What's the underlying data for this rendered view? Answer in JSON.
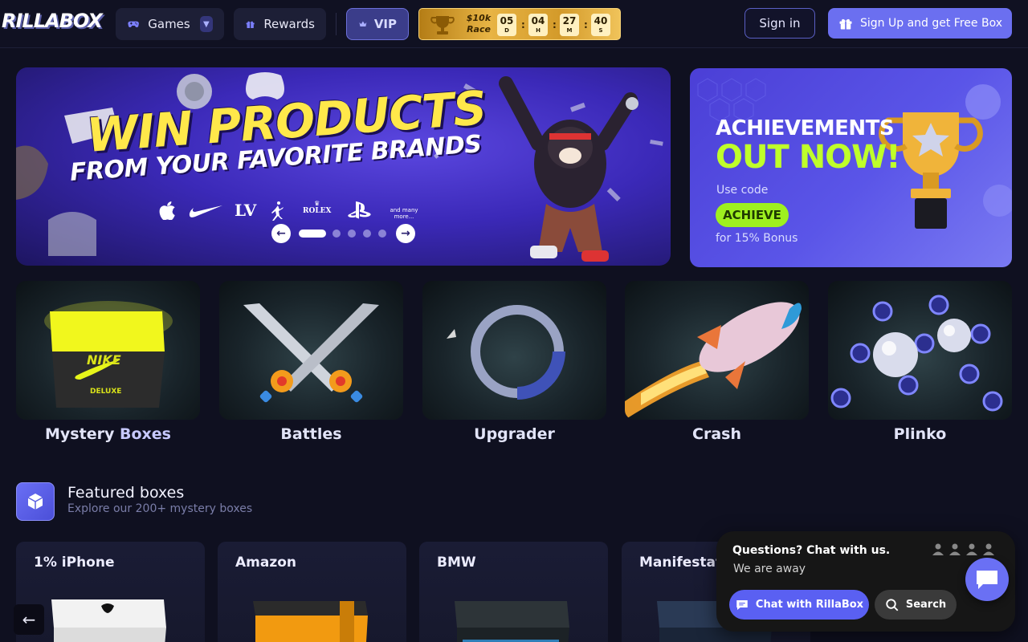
{
  "logo": "RILLABOX",
  "nav": {
    "games_label": "Games",
    "rewards_label": "Rewards",
    "vip_label": "VIP",
    "signin_label": "Sign in",
    "signup_label": "Sign Up and get Free Box"
  },
  "race": {
    "label_line1": "$10k",
    "label_line2": "Race",
    "timer": [
      {
        "value": "05",
        "unit": "D"
      },
      {
        "value": "04",
        "unit": "H"
      },
      {
        "value": "27",
        "unit": "M"
      },
      {
        "value": "40",
        "unit": "S"
      }
    ]
  },
  "hero": {
    "title_line1": "WIN PRODUCTS",
    "title_line2": "FROM YOUR FAVORITE BRANDS",
    "brands": [
      "",
      "NIKE",
      "LV",
      "JORDAN",
      "ROLEX",
      "PS",
      "and many more..."
    ],
    "brand_rolex_text": "ROLEX",
    "brand_more_text": "and many more...",
    "slides_total": 5,
    "active_slide": 1
  },
  "achievements": {
    "line1": "ACHIEVEMENTS",
    "line2": "OUT NOW!",
    "use_code": "Use code",
    "code": "ACHIEVE",
    "bonus": "for 15% Bonus"
  },
  "games": [
    {
      "label": "Mystery",
      "label_hl": "Boxes",
      "icon": "nike-deluxe-box"
    },
    {
      "label": "Battles",
      "icon": "crossed-swords"
    },
    {
      "label": "Upgrader",
      "icon": "upgrade-ring"
    },
    {
      "label": "Crash",
      "icon": "rocket"
    },
    {
      "label": "Plinko",
      "icon": "plinko-balls"
    }
  ],
  "featured": {
    "title": "Featured boxes",
    "subtitle": "Explore our 200+ mystery boxes",
    "boxes": [
      {
        "name": "1% iPhone"
      },
      {
        "name": "Amazon"
      },
      {
        "name": "BMW"
      },
      {
        "name": "Manifestatio"
      }
    ]
  },
  "chat": {
    "question": "Questions? Chat with us.",
    "status": "We are away",
    "cta": "Chat with RillaBox",
    "search": "Search"
  },
  "colors": {
    "background": "#0f1020",
    "accent": "#6b6ff0",
    "race_gold": "#e8b444",
    "achieve_green": "#9ef01f"
  }
}
